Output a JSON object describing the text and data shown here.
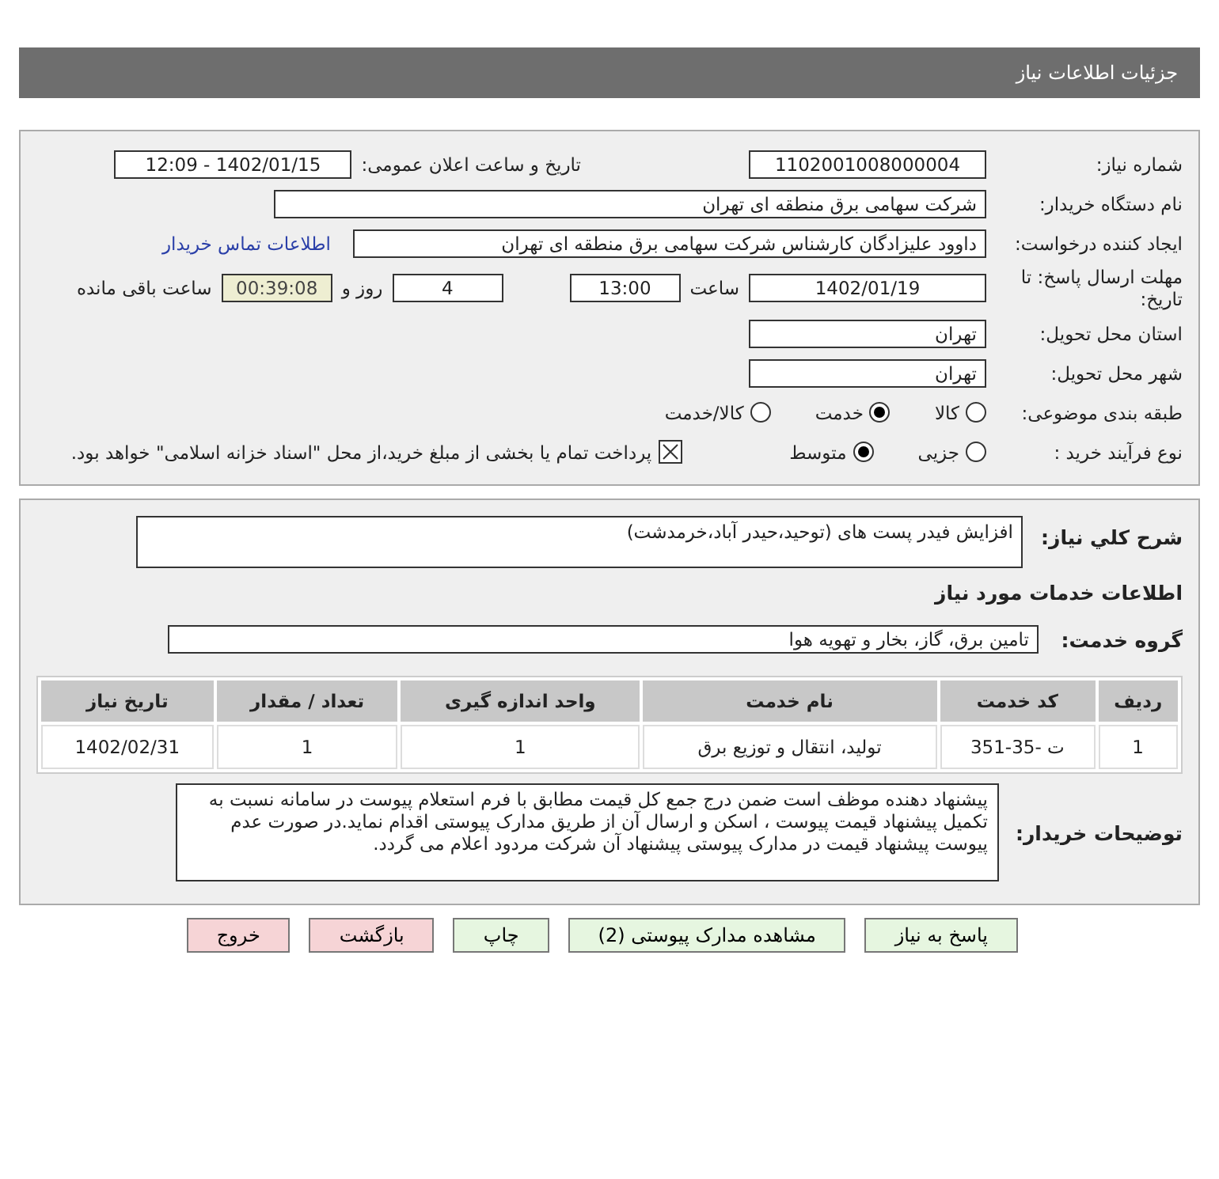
{
  "header": {
    "title": "جزئیات اطلاعات نیاز"
  },
  "details": {
    "need_number": {
      "label": "شماره نیاز:",
      "value": "1102001008000004"
    },
    "announce": {
      "label": "تاریخ و ساعت اعلان عمومی:",
      "value": "1402/01/15 - 12:09"
    },
    "buyer": {
      "label": "نام دستگاه خریدار:",
      "value": "شرکت سهامی برق منطقه ای تهران"
    },
    "creator": {
      "label": "ایجاد کننده درخواست:",
      "value": "داوود علیزادگان  کارشناس شرکت سهامی برق منطقه ای تهران",
      "link": "اطلاعات تماس خریدار"
    },
    "deadline": {
      "label": "مهلت ارسال پاسخ: تا تاریخ:",
      "date": "1402/01/19",
      "time_label": "ساعت",
      "time": "13:00",
      "days": "4",
      "days_label": "روز و",
      "remaining": "00:39:08",
      "remaining_label": "ساعت باقی مانده"
    },
    "province": {
      "label": "استان محل تحویل:",
      "value": "تهران"
    },
    "city": {
      "label": "شهر محل تحویل:",
      "value": "تهران"
    },
    "classification": {
      "label": "طبقه بندی موضوعی:",
      "options": [
        {
          "label": "کالا",
          "selected": false
        },
        {
          "label": "خدمت",
          "selected": true
        },
        {
          "label": "کالا/خدمت",
          "selected": false
        }
      ]
    },
    "process": {
      "label": "نوع فرآیند خرید :",
      "options": [
        {
          "label": "جزیی",
          "selected": false
        },
        {
          "label": "متوسط",
          "selected": true
        }
      ],
      "treasury": {
        "checked": true,
        "label": "پرداخت تمام یا بخشی از مبلغ خرید،از محل \"اسناد خزانه اسلامی\" خواهد بود."
      }
    }
  },
  "need": {
    "label": "شرح کلي نياز:",
    "value": "افزایش فیدر پست های (توحید،حیدر آباد،خرمدشت)",
    "services_heading": "اطلاعات خدمات مورد نیاز",
    "group_label": "گروه خدمت:",
    "group_value": "تامین برق، گاز، بخار و تهویه هوا",
    "table": {
      "columns": [
        "ردیف",
        "کد خدمت",
        "نام خدمت",
        "واحد اندازه گیری",
        "تعداد / مقدار",
        "تاریخ نیاز"
      ],
      "rows": [
        [
          "1",
          "ت -35-351",
          "تولید، انتقال و توزیع برق",
          "1",
          "1",
          "1402/02/31"
        ]
      ]
    },
    "notes_label": "توضیحات خریدار:",
    "notes": "پیشنهاد دهنده موظف است ضمن درج جمع کل قیمت مطابق با فرم استعلام پیوست در سامانه نسبت به تکمیل پیشنهاد قیمت پیوست ، اسکن و ارسال آن از طریق مدارک پیوستی اقدام نماید.در صورت عدم پیوست پیشنهاد قیمت در مدارک پیوستی پیشنهاد آن شرکت مردود اعلام می گردد."
  },
  "buttons": [
    {
      "label": "پاسخ به نیاز",
      "kind": "normal"
    },
    {
      "label": "مشاهده مدارک پیوستی (2)",
      "kind": "normal"
    },
    {
      "label": "چاپ",
      "kind": "normal"
    },
    {
      "label": "بازگشت",
      "kind": "exit"
    },
    {
      "label": "خروج",
      "kind": "exit"
    }
  ]
}
